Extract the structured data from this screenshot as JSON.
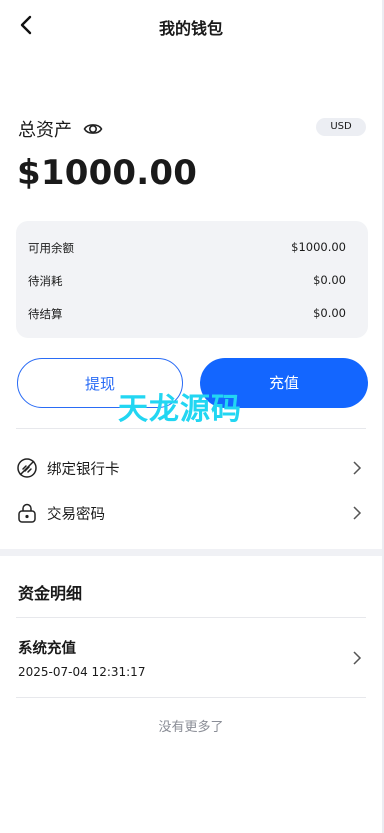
{
  "header": {
    "title": "我的钱包",
    "back_icon": "back-arrow-icon"
  },
  "assets": {
    "label": "总资产",
    "currency": "USD",
    "total": "$1000.00",
    "eye_icon": "eye-icon"
  },
  "balance_card": [
    {
      "label": "可用余额",
      "value": "$1000.00"
    },
    {
      "label": "待消耗",
      "value": "$0.00"
    },
    {
      "label": "待结算",
      "value": "$0.00"
    }
  ],
  "actions": {
    "withdraw": "提现",
    "recharge": "充值"
  },
  "watermark": "天龙源码",
  "menu": [
    {
      "label": "绑定银行卡",
      "icon": "bank-card-icon"
    },
    {
      "label": "交易密码",
      "icon": "lock-icon"
    }
  ],
  "funds": {
    "title": "资金明细",
    "items": [
      {
        "type": "系统充值",
        "time": "2025-07-04 12:31:17"
      }
    ],
    "end_text": "没有更多了"
  },
  "colors": {
    "primary": "#1366ff",
    "watermark": "#22d6f2",
    "card_bg": "#f2f3f6"
  }
}
